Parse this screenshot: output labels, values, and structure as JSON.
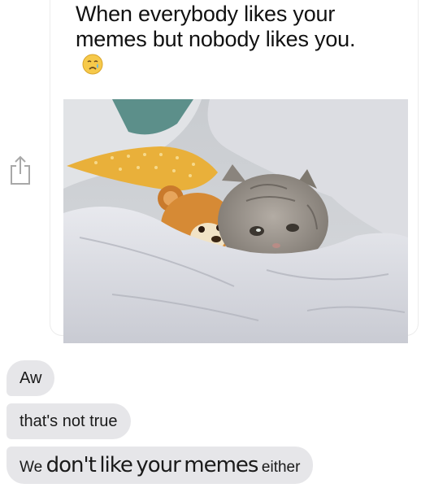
{
  "meme": {
    "caption": "When everybody likes your memes but nobody likes you.",
    "emoji": "crying-face-icon"
  },
  "messages": [
    {
      "text": "Aw"
    },
    {
      "text": "that's not true"
    },
    {
      "parts": [
        "We",
        "don't",
        "like",
        "your",
        "memes",
        "either"
      ]
    }
  ],
  "colors": {
    "bubble": "#e6e6e9",
    "text": "#1a1a1a",
    "share_icon": "#a8a8a8"
  }
}
